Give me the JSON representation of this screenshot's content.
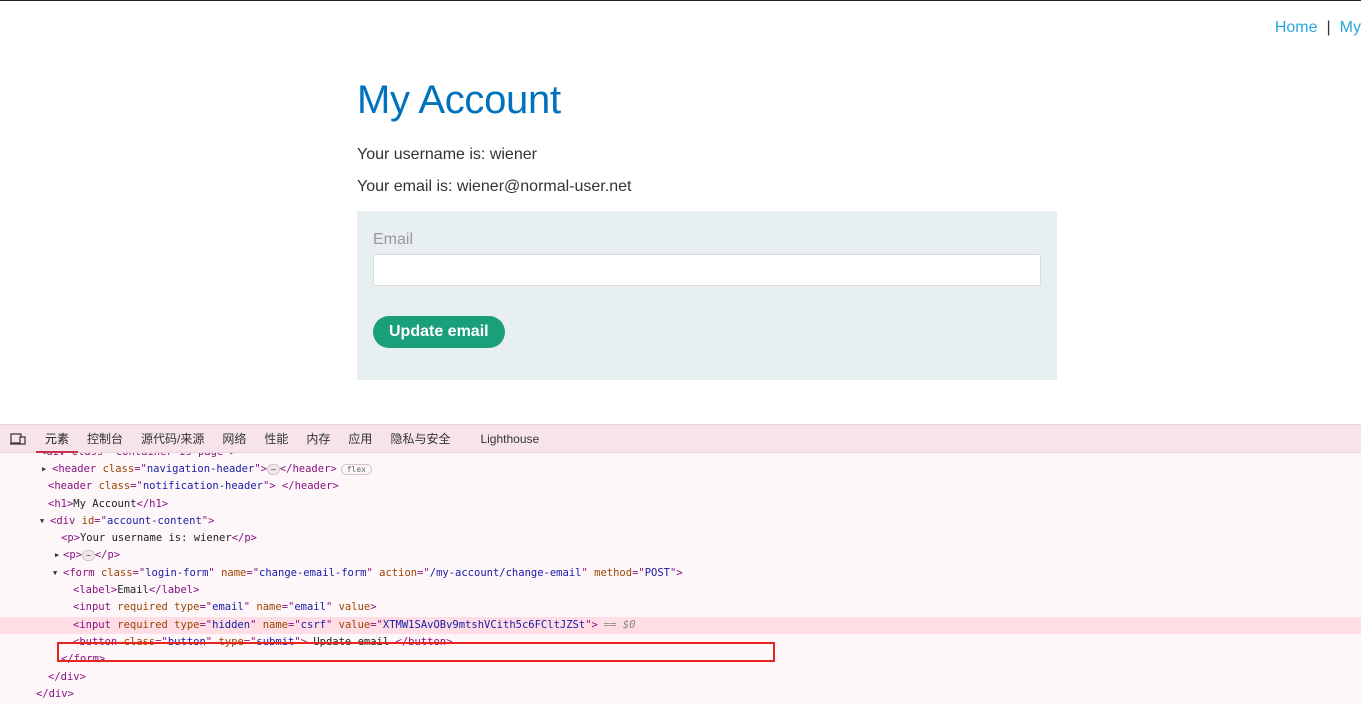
{
  "nav": {
    "home": "Home",
    "separator": "|",
    "my_account": "My"
  },
  "page": {
    "title": "My Account",
    "username_text": "Your username is: wiener",
    "email_text": "Your email is: wiener@normal-user.net",
    "form": {
      "email_label": "Email",
      "email_value": "",
      "submit_label": "Update email"
    }
  },
  "devtools": {
    "tabs": [
      "元素",
      "控制台",
      "源代码/来源",
      "网络",
      "性能",
      "内存",
      "应用",
      "隐私与安全",
      "Lighthouse"
    ],
    "active_tab": "元素",
    "dom": {
      "clipped_line": "<div class=\"container is-page\">",
      "header_nav_tag": "header",
      "header_nav_class": "navigation-header",
      "flex_badge": "flex",
      "header_notif_class": "notification-header",
      "h1_text": "My Account",
      "div_id": "account-content",
      "p_username": "Your username is: wiener",
      "form_class": "login-form",
      "form_name": "change-email-form",
      "form_action": "/my-account/change-email",
      "form_method": "POST",
      "label_text": "Email",
      "input_email_type": "email",
      "input_email_name": "email",
      "input_hidden_type": "hidden",
      "input_hidden_name": "csrf",
      "csrf_value": "XTMW1SAvOBv9mtshVCith5c6FCltJZSt",
      "selected_marker": "== $0",
      "button_class": "button",
      "button_type": "submit",
      "button_text": " Update email "
    }
  }
}
